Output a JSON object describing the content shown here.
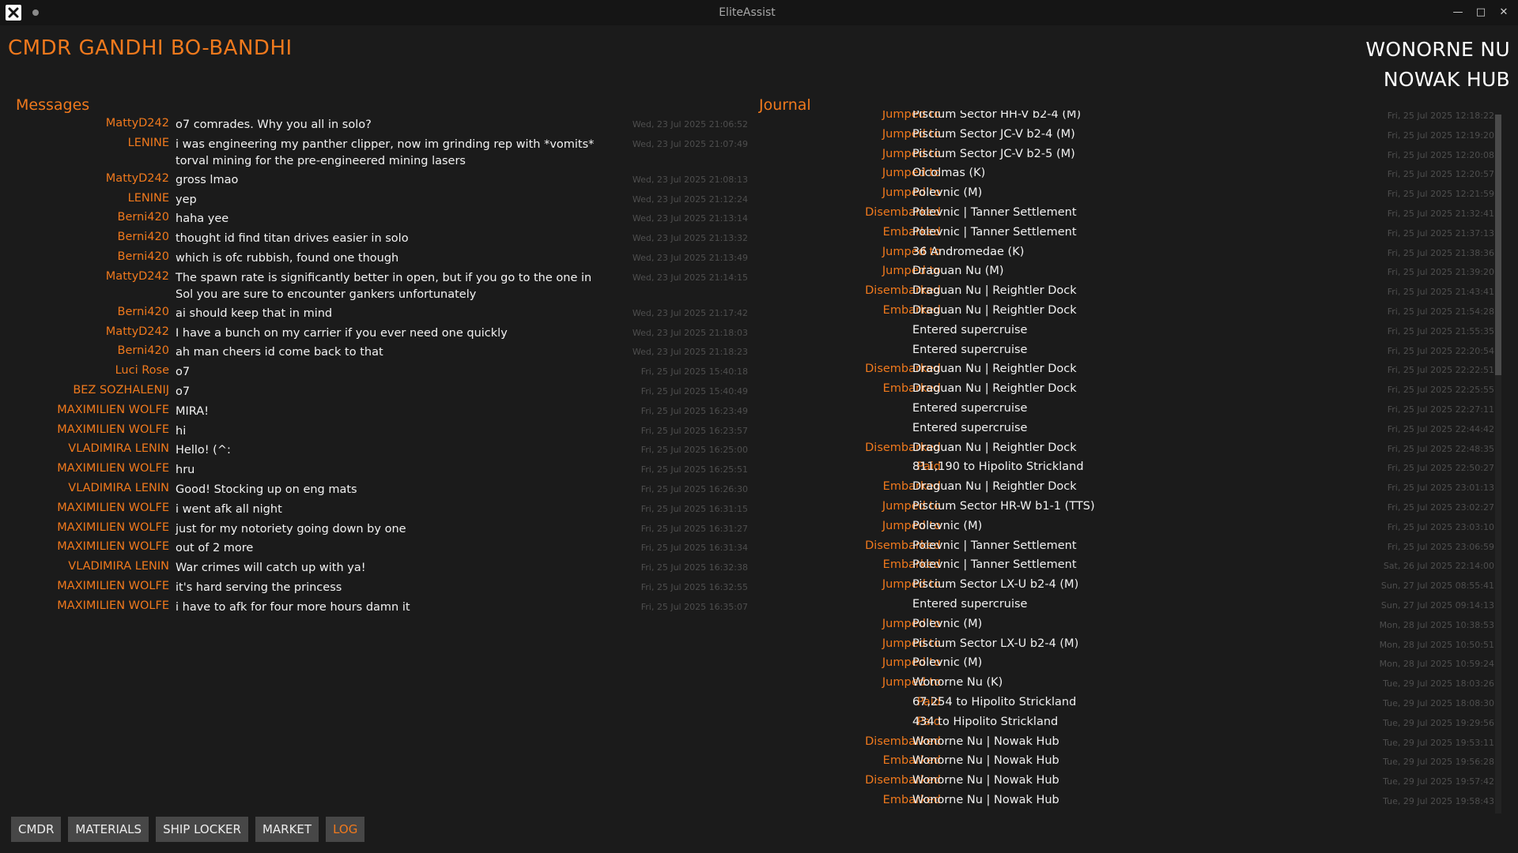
{
  "window": {
    "title": "EliteAssist"
  },
  "header": {
    "cmdr_name": "CMDR GANDHI BO-BANDHI",
    "system": "WONORNE NU",
    "station": "NOWAK HUB"
  },
  "messages": {
    "title": "Messages",
    "items": [
      {
        "from": "MattyD242",
        "text": "o7 comrades. Why you all in solo?",
        "time": "Wed, 23 Jul 2025 21:06:52"
      },
      {
        "from": "LENINE",
        "text": "i was engineering my panther clipper, now im grinding rep with *vomits* torval mining for the pre-engineered mining lasers",
        "time": "Wed, 23 Jul 2025 21:07:49"
      },
      {
        "from": "MattyD242",
        "text": "gross lmao",
        "time": "Wed, 23 Jul 2025 21:08:13"
      },
      {
        "from": "LENINE",
        "text": "yep",
        "time": "Wed, 23 Jul 2025 21:12:24"
      },
      {
        "from": "Berni420",
        "text": "haha yee",
        "time": "Wed, 23 Jul 2025 21:13:14"
      },
      {
        "from": "Berni420",
        "text": "thought id find titan drives easier in solo",
        "time": "Wed, 23 Jul 2025 21:13:32"
      },
      {
        "from": "Berni420",
        "text": "which is ofc rubbish, found one though",
        "time": "Wed, 23 Jul 2025 21:13:49"
      },
      {
        "from": "MattyD242",
        "text": "The spawn rate is significantly better in open, but if you go to the one in Sol you are sure to encounter gankers unfortunately",
        "time": "Wed, 23 Jul 2025 21:14:15"
      },
      {
        "from": "Berni420",
        "text": "ai should keep that in mind",
        "time": "Wed, 23 Jul 2025 21:17:42"
      },
      {
        "from": "MattyD242",
        "text": "I have a bunch on my carrier if you ever need one quickly",
        "time": "Wed, 23 Jul 2025 21:18:03"
      },
      {
        "from": "Berni420",
        "text": "ah man cheers id come back to that",
        "time": "Wed, 23 Jul 2025 21:18:23"
      },
      {
        "from": "Luci Rose",
        "text": "o7",
        "time": "Fri, 25 Jul 2025 15:40:18"
      },
      {
        "from": "BEZ SOZHALENIJ",
        "text": "o7",
        "time": "Fri, 25 Jul 2025 15:40:49"
      },
      {
        "from": "MAXIMILIEN WOLFE",
        "text": "MIRA!",
        "time": "Fri, 25 Jul 2025 16:23:49"
      },
      {
        "from": "MAXIMILIEN WOLFE",
        "text": "hi",
        "time": "Fri, 25 Jul 2025 16:23:57"
      },
      {
        "from": "VLADIMIRA LENIN",
        "text": "Hello! (^:",
        "time": "Fri, 25 Jul 2025 16:25:00"
      },
      {
        "from": "MAXIMILIEN WOLFE",
        "text": "hru",
        "time": "Fri, 25 Jul 2025 16:25:51"
      },
      {
        "from": "VLADIMIRA LENIN",
        "text": "Good! Stocking up on eng mats",
        "time": "Fri, 25 Jul 2025 16:26:30"
      },
      {
        "from": "MAXIMILIEN WOLFE",
        "text": "i went afk all night",
        "time": "Fri, 25 Jul 2025 16:31:15"
      },
      {
        "from": "MAXIMILIEN WOLFE",
        "text": "just for my notoriety going down by one",
        "time": "Fri, 25 Jul 2025 16:31:27"
      },
      {
        "from": "MAXIMILIEN WOLFE",
        "text": "out of 2 more",
        "time": "Fri, 25 Jul 2025 16:31:34"
      },
      {
        "from": "VLADIMIRA LENIN",
        "text": "War crimes will catch up with ya!",
        "time": "Fri, 25 Jul 2025 16:32:38"
      },
      {
        "from": "MAXIMILIEN WOLFE",
        "text": "it's hard serving the princess",
        "time": "Fri, 25 Jul 2025 16:32:55"
      },
      {
        "from": "MAXIMILIEN WOLFE",
        "text": "i have to afk for four more hours damn it",
        "time": "Fri, 25 Jul 2025 16:35:07"
      }
    ]
  },
  "journal": {
    "title": "Journal",
    "items": [
      {
        "event": "Jumped to",
        "text": "Piscium Sector HH-V b2-4 (M)",
        "time": "Fri, 25 Jul 2025 12:18:22"
      },
      {
        "event": "Jumped to",
        "text": "Piscium Sector JC-V b2-4 (M)",
        "time": "Fri, 25 Jul 2025 12:19:20"
      },
      {
        "event": "Jumped to",
        "text": "Piscium Sector JC-V b2-5 (M)",
        "time": "Fri, 25 Jul 2025 12:20:08"
      },
      {
        "event": "Jumped to",
        "text": "Oicolmas (K)",
        "time": "Fri, 25 Jul 2025 12:20:57"
      },
      {
        "event": "Jumped to",
        "text": "Polevnic (M)",
        "time": "Fri, 25 Jul 2025 12:21:59"
      },
      {
        "event": "Disembarked",
        "text": "Polevnic | Tanner Settlement",
        "time": "Fri, 25 Jul 2025 21:32:41"
      },
      {
        "event": "Embarked",
        "text": "Polevnic | Tanner Settlement",
        "time": "Fri, 25 Jul 2025 21:37:13"
      },
      {
        "event": "Jumped to",
        "text": "36 Andromedae (K)",
        "time": "Fri, 25 Jul 2025 21:38:36"
      },
      {
        "event": "Jumped to",
        "text": "Draguan Nu (M)",
        "time": "Fri, 25 Jul 2025 21:39:20"
      },
      {
        "event": "Disembarked",
        "text": "Draguan Nu | Reightler Dock",
        "time": "Fri, 25 Jul 2025 21:43:41"
      },
      {
        "event": "Embarked",
        "text": "Draguan Nu | Reightler Dock",
        "time": "Fri, 25 Jul 2025 21:54:28"
      },
      {
        "event": "",
        "text": "Entered supercruise",
        "time": "Fri, 25 Jul 2025 21:55:35"
      },
      {
        "event": "",
        "text": "Entered supercruise",
        "time": "Fri, 25 Jul 2025 22:20:54"
      },
      {
        "event": "Disembarked",
        "text": "Draguan Nu | Reightler Dock",
        "time": "Fri, 25 Jul 2025 22:22:51"
      },
      {
        "event": "Embarked",
        "text": "Draguan Nu | Reightler Dock",
        "time": "Fri, 25 Jul 2025 22:25:55"
      },
      {
        "event": "",
        "text": "Entered supercruise",
        "time": "Fri, 25 Jul 2025 22:27:11"
      },
      {
        "event": "",
        "text": "Entered supercruise",
        "time": "Fri, 25 Jul 2025 22:44:42"
      },
      {
        "event": "Disembarked",
        "text": "Draguan Nu | Reightler Dock",
        "time": "Fri, 25 Jul 2025 22:48:35"
      },
      {
        "event": "Paid",
        "text": "811,190 to Hipolito Strickland",
        "time": "Fri, 25 Jul 2025 22:50:27"
      },
      {
        "event": "Embarked",
        "text": "Draguan Nu | Reightler Dock",
        "time": "Fri, 25 Jul 2025 23:01:13"
      },
      {
        "event": "Jumped to",
        "text": "Piscium Sector HR-W b1-1 (TTS)",
        "time": "Fri, 25 Jul 2025 23:02:27"
      },
      {
        "event": "Jumped to",
        "text": "Polevnic (M)",
        "time": "Fri, 25 Jul 2025 23:03:10"
      },
      {
        "event": "Disembarked",
        "text": "Polevnic | Tanner Settlement",
        "time": "Fri, 25 Jul 2025 23:06:59"
      },
      {
        "event": "Embarked",
        "text": "Polevnic | Tanner Settlement",
        "time": "Sat, 26 Jul 2025 22:14:00"
      },
      {
        "event": "Jumped to",
        "text": "Piscium Sector LX-U b2-4 (M)",
        "time": "Sun, 27 Jul 2025 08:55:41"
      },
      {
        "event": "",
        "text": "Entered supercruise",
        "time": "Sun, 27 Jul 2025 09:14:13"
      },
      {
        "event": "Jumped to",
        "text": "Polevnic (M)",
        "time": "Mon, 28 Jul 2025 10:38:53"
      },
      {
        "event": "Jumped to",
        "text": "Piscium Sector LX-U b2-4 (M)",
        "time": "Mon, 28 Jul 2025 10:50:51"
      },
      {
        "event": "Jumped to",
        "text": "Polevnic (M)",
        "time": "Mon, 28 Jul 2025 10:59:24"
      },
      {
        "event": "Jumped to",
        "text": "Wonorne Nu (K)",
        "time": "Tue, 29 Jul 2025 18:03:26"
      },
      {
        "event": "Paid",
        "text": "67,254 to Hipolito Strickland",
        "time": "Tue, 29 Jul 2025 18:08:30"
      },
      {
        "event": "Paid",
        "text": "434 to Hipolito Strickland",
        "time": "Tue, 29 Jul 2025 19:29:56"
      },
      {
        "event": "Disembarked",
        "text": "Wonorne Nu | Nowak Hub",
        "time": "Tue, 29 Jul 2025 19:53:11"
      },
      {
        "event": "Embarked",
        "text": "Wonorne Nu | Nowak Hub",
        "time": "Tue, 29 Jul 2025 19:56:28"
      },
      {
        "event": "Disembarked",
        "text": "Wonorne Nu | Nowak Hub",
        "time": "Tue, 29 Jul 2025 19:57:42"
      },
      {
        "event": "Embarked",
        "text": "Wonorne Nu | Nowak Hub",
        "time": "Tue, 29 Jul 2025 19:58:43"
      }
    ]
  },
  "tabs": [
    {
      "label": "CMDR",
      "active": false
    },
    {
      "label": "MATERIALS",
      "active": false
    },
    {
      "label": "SHIP LOCKER",
      "active": false
    },
    {
      "label": "MARKET",
      "active": false
    },
    {
      "label": "LOG",
      "active": true
    }
  ],
  "icons": {
    "app": "x-logo-icon",
    "status": "dot-icon",
    "minimize": "minimize-icon",
    "maximize": "maximize-icon",
    "close": "close-icon"
  },
  "colors": {
    "accent": "#f0791d",
    "background": "#1b1b1b",
    "titlebar": "#151515",
    "tab": "#474747",
    "timestamp": "#4e4e4e"
  }
}
